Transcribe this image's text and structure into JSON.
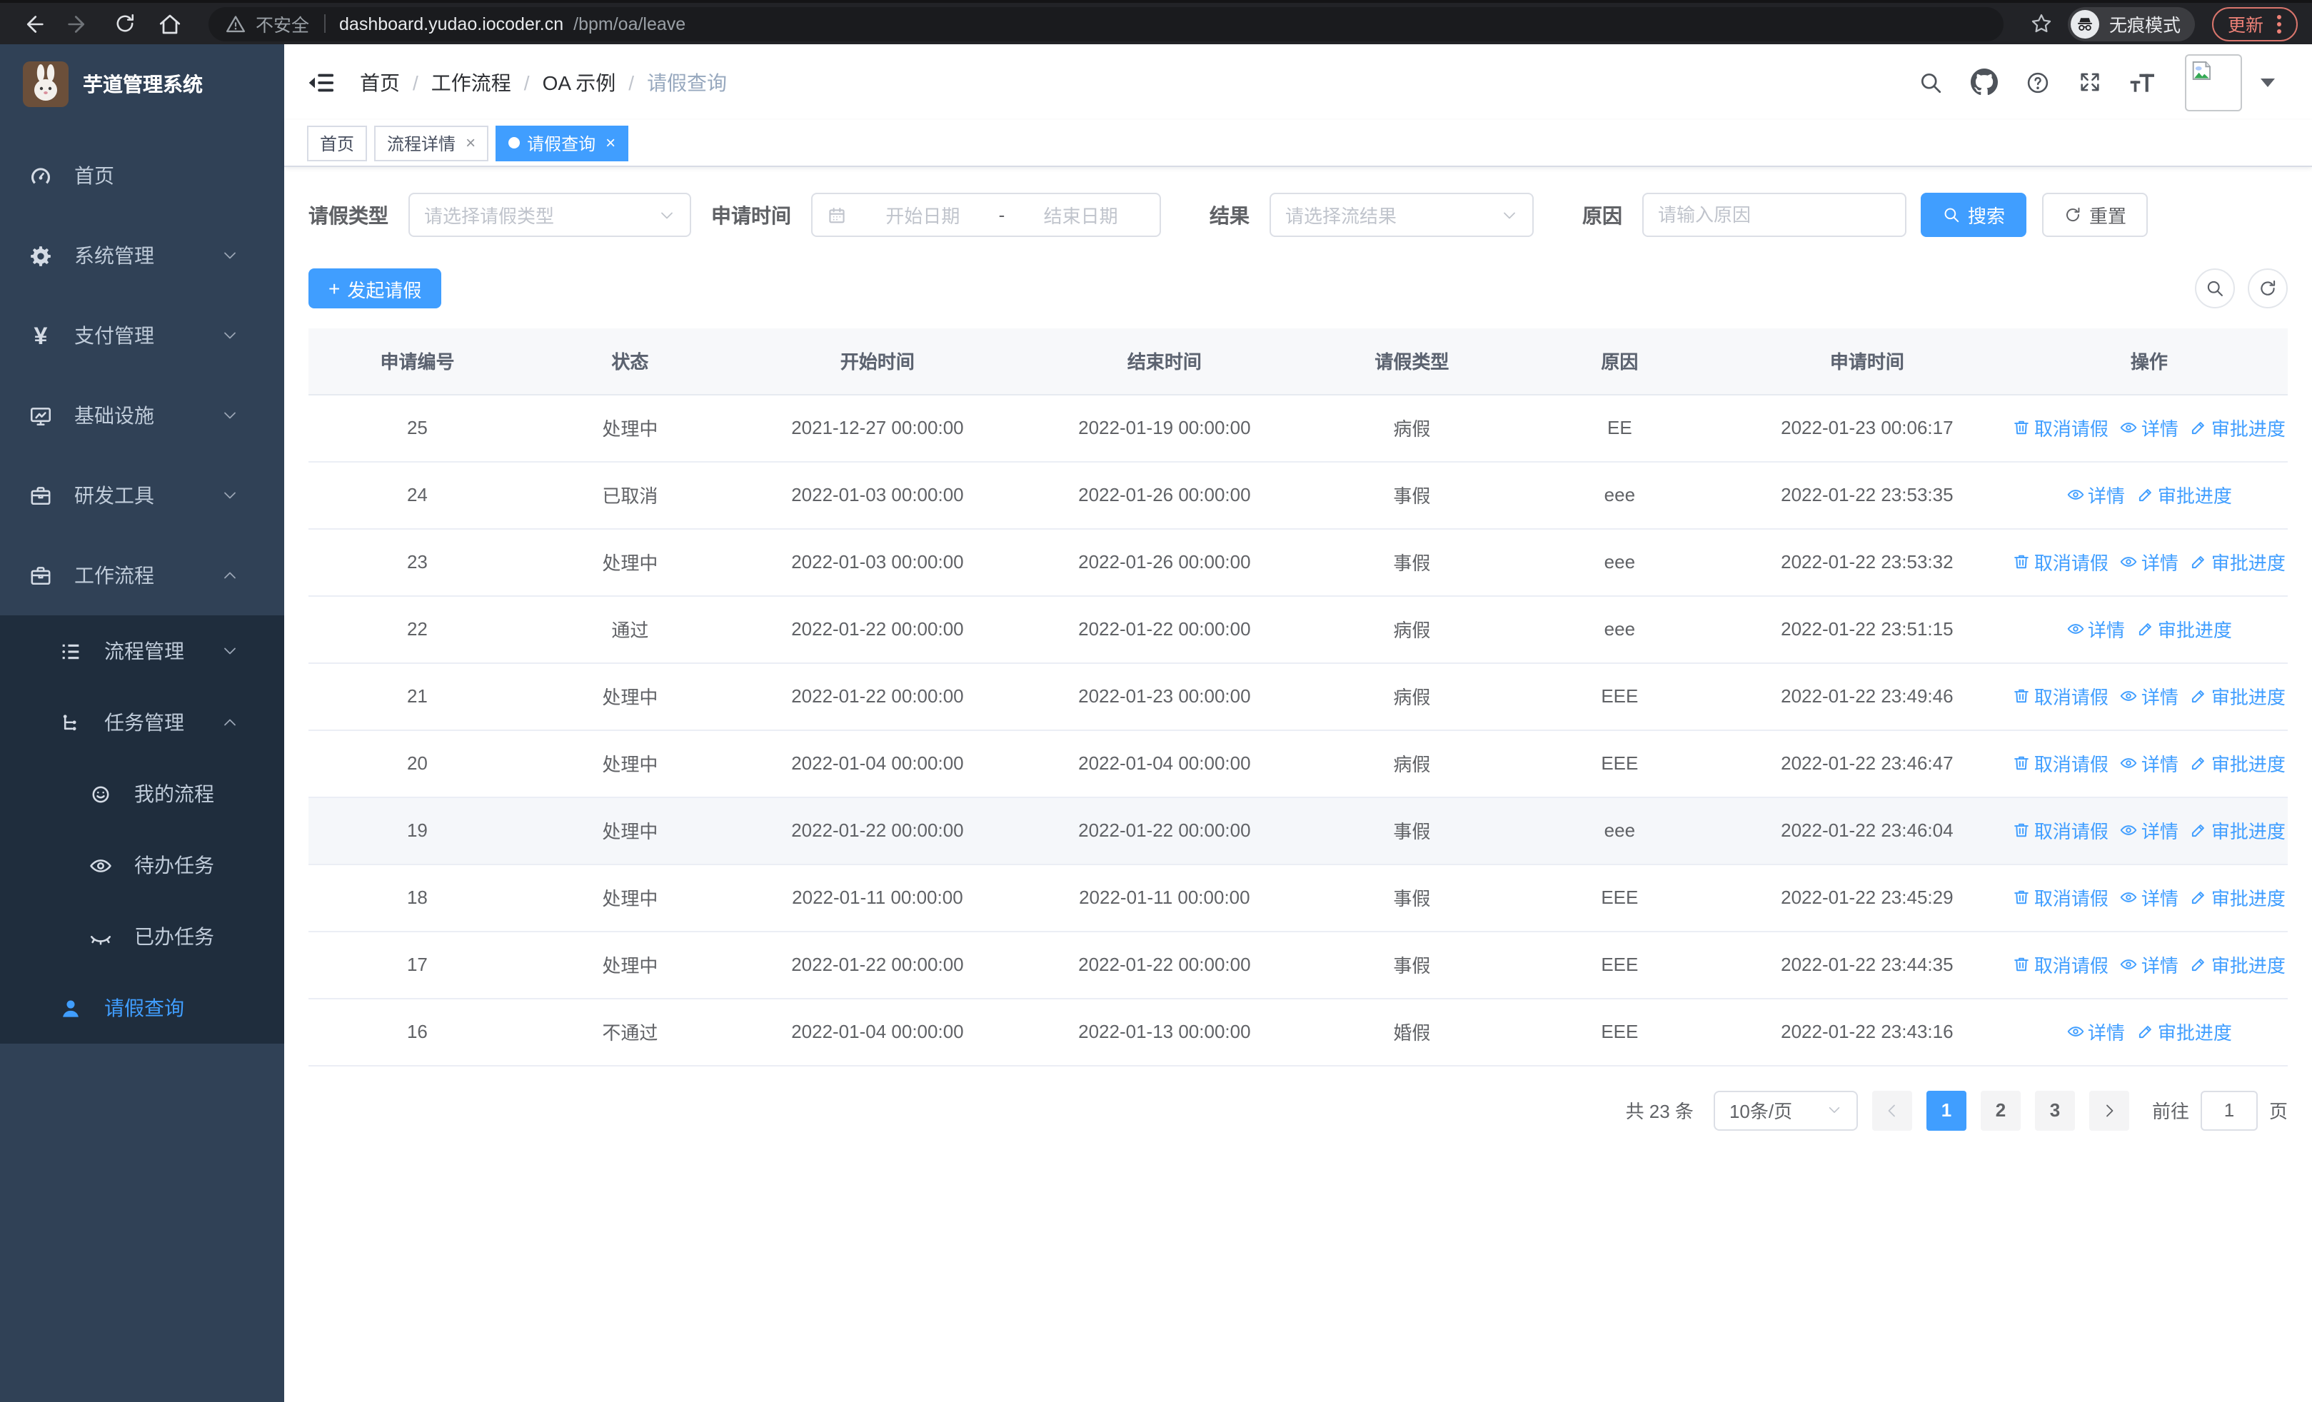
{
  "colors": {
    "accent": "#409eff",
    "sidebar_bg": "#304156",
    "submenu_bg": "#1f2d3d",
    "sidebar_text": "#bfcbd9",
    "update_salmon": "#ee8177"
  },
  "browser": {
    "security_label": "不安全",
    "url_host": "dashboard.yudao.iocoder.cn",
    "url_path": "/bpm/oa/leave",
    "incognito_label": "无痕模式",
    "update_label": "更新"
  },
  "sidebar": {
    "logo_title": "芋道管理系统",
    "menu": [
      {
        "label": "首页",
        "icon": "dashboard",
        "indent": 1,
        "arrow": "",
        "active": false,
        "sub": false
      },
      {
        "label": "系统管理",
        "icon": "gear",
        "indent": 1,
        "arrow": "down",
        "active": false,
        "sub": false
      },
      {
        "label": "支付管理",
        "icon": "yen",
        "indent": 1,
        "arrow": "down",
        "active": false,
        "sub": false
      },
      {
        "label": "基础设施",
        "icon": "monitor",
        "indent": 1,
        "arrow": "down",
        "active": false,
        "sub": false
      },
      {
        "label": "研发工具",
        "icon": "briefcase",
        "indent": 1,
        "arrow": "down",
        "active": false,
        "sub": false
      },
      {
        "label": "工作流程",
        "icon": "briefcase",
        "indent": 1,
        "arrow": "up",
        "active": false,
        "sub": false
      },
      {
        "label": "流程管理",
        "icon": "list",
        "indent": 2,
        "arrow": "down",
        "active": false,
        "sub": true
      },
      {
        "label": "任务管理",
        "icon": "tree",
        "indent": 2,
        "arrow": "up",
        "active": false,
        "sub": true
      },
      {
        "label": "我的流程",
        "icon": "face",
        "indent": 3,
        "arrow": "",
        "active": false,
        "sub": true
      },
      {
        "label": "待办任务",
        "icon": "eye",
        "indent": 3,
        "arrow": "",
        "active": false,
        "sub": true
      },
      {
        "label": "已办任务",
        "icon": "eye-closed",
        "indent": 3,
        "arrow": "",
        "active": false,
        "sub": true
      },
      {
        "label": "请假查询",
        "icon": "user",
        "indent": 2,
        "arrow": "",
        "active": true,
        "sub": true
      }
    ]
  },
  "navbar": {
    "breadcrumb": [
      "首页",
      "工作流程",
      "OA 示例",
      "请假查询"
    ]
  },
  "tags": [
    {
      "label": "首页",
      "closable": false,
      "active": false
    },
    {
      "label": "流程详情",
      "closable": true,
      "active": false
    },
    {
      "label": "请假查询",
      "closable": true,
      "active": true
    }
  ],
  "filters": {
    "leave_type_label": "请假类型",
    "leave_type_placeholder": "请选择请假类型",
    "apply_time_label": "申请时间",
    "start_placeholder": "开始日期",
    "range_separator": "-",
    "end_placeholder": "结束日期",
    "result_label": "结果",
    "result_placeholder": "请选择流结果",
    "reason_label": "原因",
    "reason_placeholder": "请输入原因",
    "search_label": "搜索",
    "reset_label": "重置"
  },
  "toolbar": {
    "create_label": "发起请假"
  },
  "table": {
    "columns": [
      "申请编号",
      "状态",
      "开始时间",
      "结束时间",
      "请假类型",
      "原因",
      "申请时间",
      "操作"
    ],
    "action_labels": {
      "cancel": "取消请假",
      "detail": "详情",
      "progress": "审批进度"
    },
    "rows": [
      {
        "id": "25",
        "status": "处理中",
        "start": "2021-12-27 00:00:00",
        "end": "2022-01-19 00:00:00",
        "type": "病假",
        "reason": "EE",
        "apply_time": "2022-01-23 00:06:17",
        "actions": [
          "cancel",
          "detail",
          "progress"
        ],
        "highlighted": false
      },
      {
        "id": "24",
        "status": "已取消",
        "start": "2022-01-03 00:00:00",
        "end": "2022-01-26 00:00:00",
        "type": "事假",
        "reason": "eee",
        "apply_time": "2022-01-22 23:53:35",
        "actions": [
          "detail",
          "progress"
        ],
        "highlighted": false
      },
      {
        "id": "23",
        "status": "处理中",
        "start": "2022-01-03 00:00:00",
        "end": "2022-01-26 00:00:00",
        "type": "事假",
        "reason": "eee",
        "apply_time": "2022-01-22 23:53:32",
        "actions": [
          "cancel",
          "detail",
          "progress"
        ],
        "highlighted": false
      },
      {
        "id": "22",
        "status": "通过",
        "start": "2022-01-22 00:00:00",
        "end": "2022-01-22 00:00:00",
        "type": "病假",
        "reason": "eee",
        "apply_time": "2022-01-22 23:51:15",
        "actions": [
          "detail",
          "progress"
        ],
        "highlighted": false
      },
      {
        "id": "21",
        "status": "处理中",
        "start": "2022-01-22 00:00:00",
        "end": "2022-01-23 00:00:00",
        "type": "病假",
        "reason": "EEE",
        "apply_time": "2022-01-22 23:49:46",
        "actions": [
          "cancel",
          "detail",
          "progress"
        ],
        "highlighted": false
      },
      {
        "id": "20",
        "status": "处理中",
        "start": "2022-01-04 00:00:00",
        "end": "2022-01-04 00:00:00",
        "type": "病假",
        "reason": "EEE",
        "apply_time": "2022-01-22 23:46:47",
        "actions": [
          "cancel",
          "detail",
          "progress"
        ],
        "highlighted": false
      },
      {
        "id": "19",
        "status": "处理中",
        "start": "2022-01-22 00:00:00",
        "end": "2022-01-22 00:00:00",
        "type": "事假",
        "reason": "eee",
        "apply_time": "2022-01-22 23:46:04",
        "actions": [
          "cancel",
          "detail",
          "progress"
        ],
        "highlighted": true
      },
      {
        "id": "18",
        "status": "处理中",
        "start": "2022-01-11 00:00:00",
        "end": "2022-01-11 00:00:00",
        "type": "事假",
        "reason": "EEE",
        "apply_time": "2022-01-22 23:45:29",
        "actions": [
          "cancel",
          "detail",
          "progress"
        ],
        "highlighted": false
      },
      {
        "id": "17",
        "status": "处理中",
        "start": "2022-01-22 00:00:00",
        "end": "2022-01-22 00:00:00",
        "type": "事假",
        "reason": "EEE",
        "apply_time": "2022-01-22 23:44:35",
        "actions": [
          "cancel",
          "detail",
          "progress"
        ],
        "highlighted": false
      },
      {
        "id": "16",
        "status": "不通过",
        "start": "2022-01-04 00:00:00",
        "end": "2022-01-13 00:00:00",
        "type": "婚假",
        "reason": "EEE",
        "apply_time": "2022-01-22 23:43:16",
        "actions": [
          "detail",
          "progress"
        ],
        "highlighted": false
      }
    ]
  },
  "pagination": {
    "total_text": "共 23 条",
    "page_size": "10条/页",
    "pages": [
      "1",
      "2",
      "3"
    ],
    "current_page": "1",
    "goto_label": "前往",
    "goto_value": "1",
    "page_unit": "页"
  }
}
